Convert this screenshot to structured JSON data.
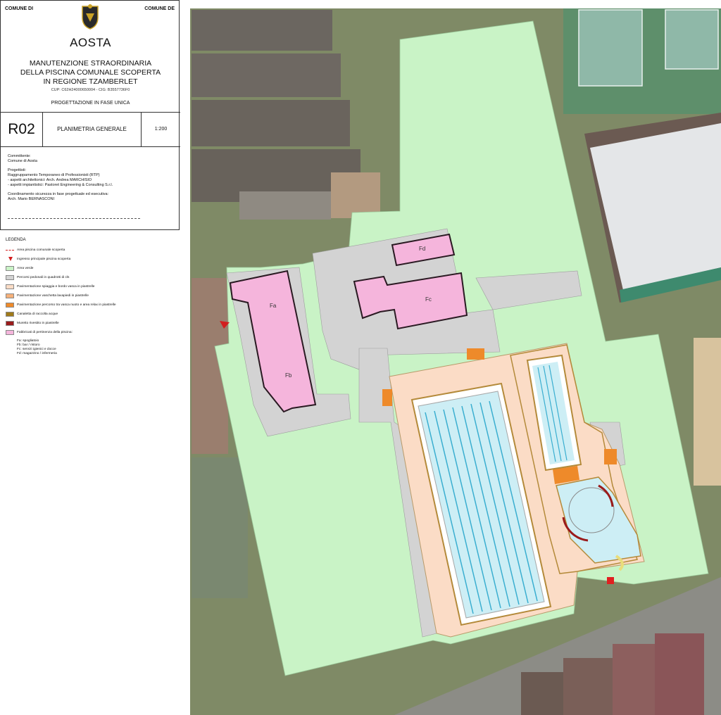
{
  "header": {
    "comune_left": "COMUNE DI",
    "comune_right": "COMUNE DE",
    "city": "AOSTA",
    "project_lines": [
      "MANUTENZIONE STRAORDINARIA",
      "DELLA PISCINA COMUNALE SCOPERTA",
      "IN REGIONE TZAMBERLET"
    ],
    "cup": "CUP: C62H24000650004 - CIG: B3557736F0",
    "phase": "PROGETTAZIONE IN FASE UNICA"
  },
  "sheet": {
    "code": "R02",
    "title": "PLANIMETRIA GENERALE",
    "scale": "1:200"
  },
  "credits": {
    "committente_label": "Committente:",
    "committente": "Comune di Aosta",
    "progettisti_label": "Progettisti:",
    "rtp": "Raggruppamento Temporaneo di Professionisti (RTP)",
    "arch": "- aspetti architettonici: Arch. Andrea MARCHISIO",
    "impianti": "- aspetti impiantistici: Pastoret Engineering & Consulting S.r.l.",
    "sicurezza_label": "Coordinamento sicurezza in fase progettuale ed esecutiva:",
    "sicurezza": "Arch. Mario BERNASCONI"
  },
  "legend": {
    "title": "LEGENDA",
    "items": [
      {
        "label": "Area piscina comunale scoperta",
        "color": "#d21e1e",
        "kind": "dash"
      },
      {
        "label": "Ingresso principale piscina scoperta",
        "color": "#d21e1e",
        "kind": "arrow"
      },
      {
        "label": "Area verde",
        "color": "#c9f3c6",
        "kind": "box"
      },
      {
        "label": "Percorsi pedonali in quadrotti di cls",
        "color": "#d3d3d3",
        "kind": "box"
      },
      {
        "label": "Pavimentazione spiaggia e bordo vasca in piastrelle",
        "color": "#fbdcc6",
        "kind": "box"
      },
      {
        "label": "Pavimentazione vaschetta lavapiedi in piastrelle",
        "color": "#f5b07a",
        "kind": "box"
      },
      {
        "label": "Pavimentazione percorso tra vasca nuoto e area relax in piastrelle",
        "color": "#ee8a2a",
        "kind": "box"
      },
      {
        "label": "Canaletta di raccolta acque",
        "color": "#a07a1a",
        "kind": "box"
      },
      {
        "label": "Muretto rivestito in piastrelle",
        "color": "#9a1b1b",
        "kind": "box"
      },
      {
        "label": "Fabbricati di pertinenza della piscina:",
        "color": "#f5b5dc",
        "kind": "box"
      }
    ],
    "buildings": [
      "Fa: spogliatoio",
      "Fb: bar / ristoro",
      "Fc: servizi igienici e docce",
      "Fd: magazzino / infermeria"
    ]
  },
  "plan": {
    "labels": {
      "fa": "Fa",
      "fb": "Fb",
      "fc": "Fc",
      "fd": "Fd"
    },
    "colors": {
      "green": "#c9f3c6",
      "grey": "#d3d3d3",
      "beach": "#fbdcc6",
      "pink": "#f5b5dc",
      "pool": "#cdeef5",
      "lane": "#3aaed0"
    }
  }
}
